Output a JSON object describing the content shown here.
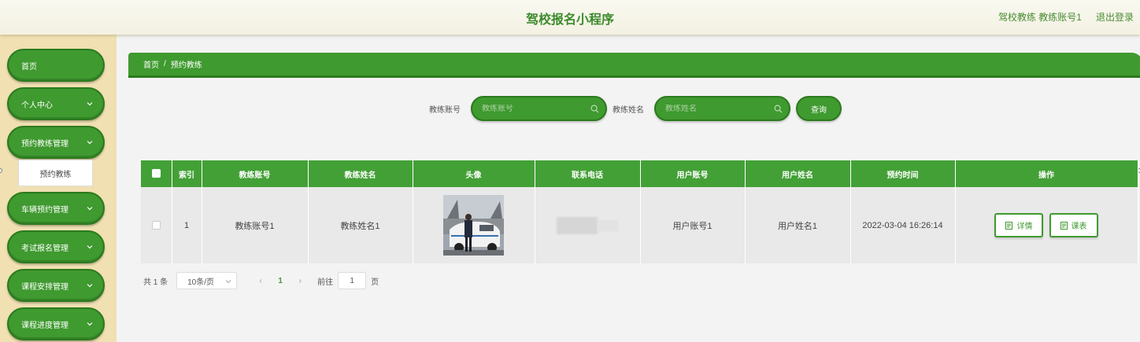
{
  "header": {
    "app_title": "驾校报名小程序",
    "user_label": "驾校教练 教练账号1",
    "logout": "退出登录"
  },
  "sidebar": {
    "items": [
      {
        "label": "首页",
        "has_chevron": false
      },
      {
        "label": "个人中心",
        "has_chevron": true
      },
      {
        "label": "预约教练管理",
        "has_chevron": true
      },
      {
        "label": "车辆预约管理",
        "has_chevron": true
      },
      {
        "label": "考试报名管理",
        "has_chevron": true
      },
      {
        "label": "课程安排管理",
        "has_chevron": true
      },
      {
        "label": "课程进度管理",
        "has_chevron": true
      }
    ],
    "sub_item": "预约教练"
  },
  "breadcrumb": {
    "home": "首页",
    "separator": "/",
    "current": "预约教练"
  },
  "search": {
    "coach_account_label": "教练账号",
    "coach_account_placeholder": "教练账号",
    "coach_name_label": "教练姓名",
    "coach_name_placeholder": "教练姓名",
    "query_button": "查询"
  },
  "table": {
    "headers": [
      "",
      "索引",
      "教练账号",
      "教练姓名",
      "头像",
      "联系电话",
      "用户账号",
      "用户姓名",
      "预约时间",
      "操作"
    ],
    "rows": [
      {
        "index": "1",
        "coach_account": "教练账号1",
        "coach_name": "教练姓名1",
        "avatar_icon": "coach-photo",
        "phone": "",
        "user_account": "用户账号1",
        "user_name": "用户姓名1",
        "appointment_time": "2022-03-04 16:26:14",
        "actions": {
          "detail": "详情",
          "schedule": "课表"
        }
      }
    ]
  },
  "pagination": {
    "total": "共 1 条",
    "page_size": "10条/页",
    "prev": "‹",
    "current_page": "1",
    "next": "›",
    "goto_label": "前往",
    "goto_value": "1",
    "page_suffix": "页"
  },
  "colors": {
    "primary_green": "#3f9a2f",
    "dark_green": "#2b7a1d",
    "sidebar_bg": "#f0e0b2",
    "header_bg": "#f6f5e8",
    "title_green": "#3c8a2d"
  }
}
